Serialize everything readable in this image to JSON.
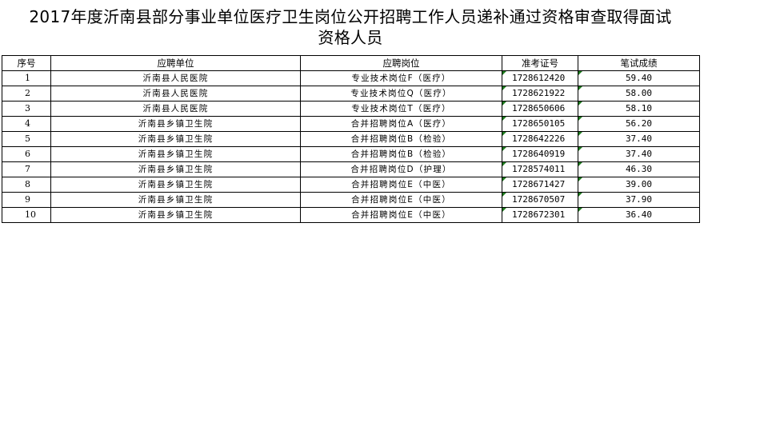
{
  "document": {
    "title_line1": "2017年度沂南县部分事业单位医疗卫生岗位公开招聘工作人员递补通过资格审查取得面试",
    "title_line2": "资格人员"
  },
  "table": {
    "headers": [
      "序号",
      "应聘单位",
      "应聘岗位",
      "准考证号",
      "笔试成绩"
    ],
    "rows": [
      {
        "seq": "1",
        "unit": "沂南县人民医院",
        "post": "专业技术岗位F（医疗）",
        "exam_no": "1728612420",
        "score": "59.40"
      },
      {
        "seq": "2",
        "unit": "沂南县人民医院",
        "post": "专业技术岗位Q（医疗）",
        "exam_no": "1728621922",
        "score": "58.00"
      },
      {
        "seq": "3",
        "unit": "沂南县人民医院",
        "post": "专业技术岗位T（医疗）",
        "exam_no": "1728650606",
        "score": "58.10"
      },
      {
        "seq": "4",
        "unit": "沂南县乡镇卫生院",
        "post": "合并招聘岗位A（医疗）",
        "exam_no": "1728650105",
        "score": "56.20"
      },
      {
        "seq": "5",
        "unit": "沂南县乡镇卫生院",
        "post": "合并招聘岗位B（检验）",
        "exam_no": "1728642226",
        "score": "37.40"
      },
      {
        "seq": "6",
        "unit": "沂南县乡镇卫生院",
        "post": "合并招聘岗位B（检验）",
        "exam_no": "1728640919",
        "score": "37.40"
      },
      {
        "seq": "7",
        "unit": "沂南县乡镇卫生院",
        "post": "合并招聘岗位D（护理）",
        "exam_no": "1728574011",
        "score": "46.30"
      },
      {
        "seq": "8",
        "unit": "沂南县乡镇卫生院",
        "post": "合并招聘岗位E（中医）",
        "exam_no": "1728671427",
        "score": "39.00"
      },
      {
        "seq": "9",
        "unit": "沂南县乡镇卫生院",
        "post": "合并招聘岗位E（中医）",
        "exam_no": "1728670507",
        "score": "37.90"
      },
      {
        "seq": "10",
        "unit": "沂南县乡镇卫生院",
        "post": "合并招聘岗位E（中医）",
        "exam_no": "1728672301",
        "score": "36.40"
      }
    ]
  }
}
